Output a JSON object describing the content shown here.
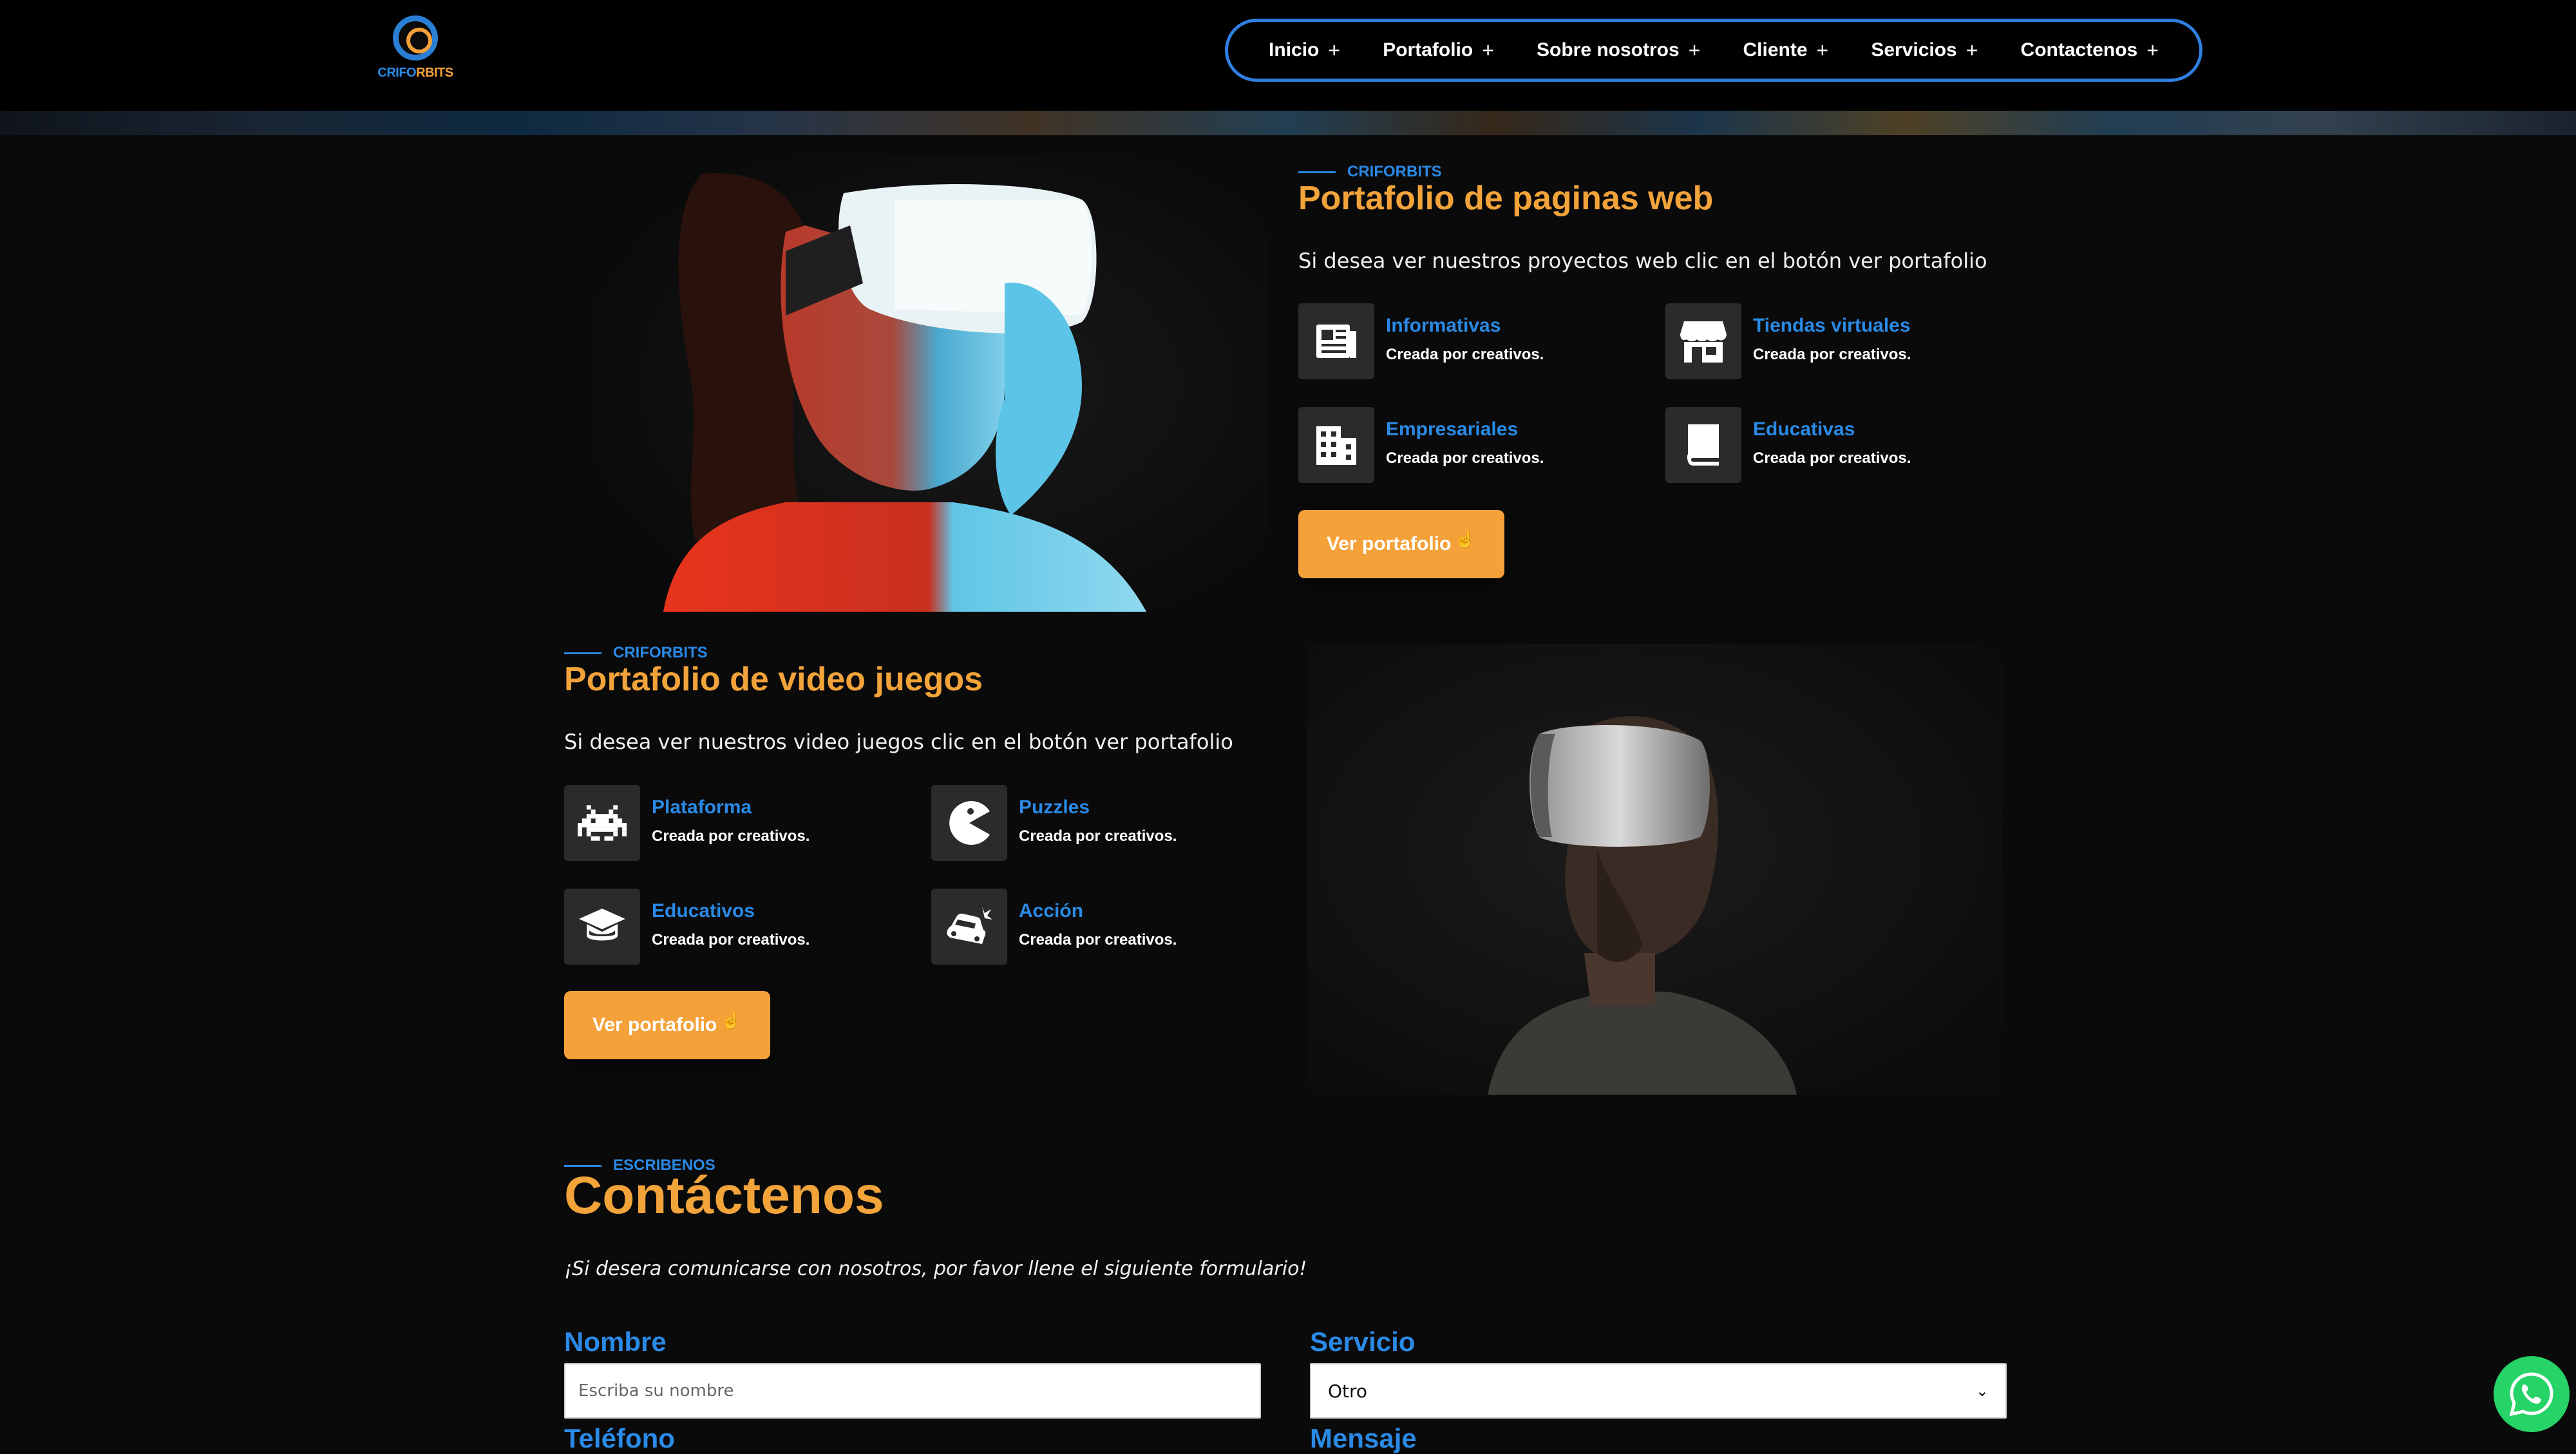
{
  "brand": {
    "logo_text_a": "CRIFO",
    "logo_text_b": "RBITS"
  },
  "nav": {
    "items": [
      {
        "label": "Inicio"
      },
      {
        "label": "Portafolio"
      },
      {
        "label": "Sobre nosotros"
      },
      {
        "label": "Cliente"
      },
      {
        "label": "Servicios"
      },
      {
        "label": "Contactenos"
      }
    ]
  },
  "web_section": {
    "eyebrow": "CRIFORBITS",
    "title": "Portafolio de paginas web",
    "description": "Si desea ver nuestros proyectos web clic en el botón ver portafolio",
    "features": [
      {
        "title": "Informativas",
        "subtitle": "Creada por creativos.",
        "icon": "newspaper-icon"
      },
      {
        "title": "Tiendas virtuales",
        "subtitle": "Creada por creativos.",
        "icon": "store-icon"
      },
      {
        "title": "Empresariales",
        "subtitle": "Creada por creativos.",
        "icon": "building-icon"
      },
      {
        "title": "Educativas",
        "subtitle": "Creada por creativos.",
        "icon": "book-icon"
      }
    ],
    "button_label": "Ver portafolio"
  },
  "games_section": {
    "eyebrow": "CRIFORBITS",
    "title": "Portafolio de video juegos",
    "description": "Si desea ver nuestros video juegos clic en el botón ver portafolio",
    "features": [
      {
        "title": "Plataforma",
        "subtitle": "Creada por creativos.",
        "icon": "space-invader-icon"
      },
      {
        "title": "Puzzles",
        "subtitle": "Creada por creativos.",
        "icon": "pacman-icon"
      },
      {
        "title": "Educativos",
        "subtitle": "Creada por creativos.",
        "icon": "graduation-cap-icon"
      },
      {
        "title": "Acción",
        "subtitle": "Creada por creativos.",
        "icon": "car-crash-icon"
      }
    ],
    "button_label": "Ver portafolio"
  },
  "contact": {
    "eyebrow": "ESCRIBENOS",
    "title": "Contáctenos",
    "intro": "¡Si desera comunicarse con nosotros, por favor llene el siguiente formulario!",
    "name_label": "Nombre",
    "name_placeholder": "Escriba su nombre",
    "service_label": "Servicio",
    "service_value": "Otro",
    "phone_label": "Teléfono",
    "message_label": "Mensaje"
  },
  "colors": {
    "accent_orange": "#f5a13a",
    "accent_blue": "#2a8ae6",
    "background": "#0a0a0a",
    "whatsapp": "#25d366"
  }
}
